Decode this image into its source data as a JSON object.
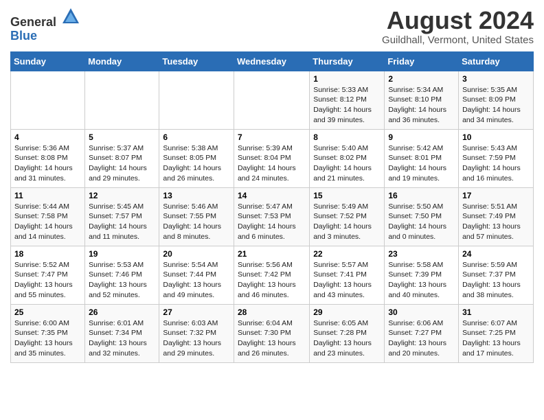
{
  "header": {
    "logo_general": "General",
    "logo_blue": "Blue",
    "month": "August 2024",
    "location": "Guildhall, Vermont, United States"
  },
  "days_of_week": [
    "Sunday",
    "Monday",
    "Tuesday",
    "Wednesday",
    "Thursday",
    "Friday",
    "Saturday"
  ],
  "weeks": [
    [
      {
        "day": "",
        "info": ""
      },
      {
        "day": "",
        "info": ""
      },
      {
        "day": "",
        "info": ""
      },
      {
        "day": "",
        "info": ""
      },
      {
        "day": "1",
        "info": "Sunrise: 5:33 AM\nSunset: 8:12 PM\nDaylight: 14 hours and 39 minutes."
      },
      {
        "day": "2",
        "info": "Sunrise: 5:34 AM\nSunset: 8:10 PM\nDaylight: 14 hours and 36 minutes."
      },
      {
        "day": "3",
        "info": "Sunrise: 5:35 AM\nSunset: 8:09 PM\nDaylight: 14 hours and 34 minutes."
      }
    ],
    [
      {
        "day": "4",
        "info": "Sunrise: 5:36 AM\nSunset: 8:08 PM\nDaylight: 14 hours and 31 minutes."
      },
      {
        "day": "5",
        "info": "Sunrise: 5:37 AM\nSunset: 8:07 PM\nDaylight: 14 hours and 29 minutes."
      },
      {
        "day": "6",
        "info": "Sunrise: 5:38 AM\nSunset: 8:05 PM\nDaylight: 14 hours and 26 minutes."
      },
      {
        "day": "7",
        "info": "Sunrise: 5:39 AM\nSunset: 8:04 PM\nDaylight: 14 hours and 24 minutes."
      },
      {
        "day": "8",
        "info": "Sunrise: 5:40 AM\nSunset: 8:02 PM\nDaylight: 14 hours and 21 minutes."
      },
      {
        "day": "9",
        "info": "Sunrise: 5:42 AM\nSunset: 8:01 PM\nDaylight: 14 hours and 19 minutes."
      },
      {
        "day": "10",
        "info": "Sunrise: 5:43 AM\nSunset: 7:59 PM\nDaylight: 14 hours and 16 minutes."
      }
    ],
    [
      {
        "day": "11",
        "info": "Sunrise: 5:44 AM\nSunset: 7:58 PM\nDaylight: 14 hours and 14 minutes."
      },
      {
        "day": "12",
        "info": "Sunrise: 5:45 AM\nSunset: 7:57 PM\nDaylight: 14 hours and 11 minutes."
      },
      {
        "day": "13",
        "info": "Sunrise: 5:46 AM\nSunset: 7:55 PM\nDaylight: 14 hours and 8 minutes."
      },
      {
        "day": "14",
        "info": "Sunrise: 5:47 AM\nSunset: 7:53 PM\nDaylight: 14 hours and 6 minutes."
      },
      {
        "day": "15",
        "info": "Sunrise: 5:49 AM\nSunset: 7:52 PM\nDaylight: 14 hours and 3 minutes."
      },
      {
        "day": "16",
        "info": "Sunrise: 5:50 AM\nSunset: 7:50 PM\nDaylight: 14 hours and 0 minutes."
      },
      {
        "day": "17",
        "info": "Sunrise: 5:51 AM\nSunset: 7:49 PM\nDaylight: 13 hours and 57 minutes."
      }
    ],
    [
      {
        "day": "18",
        "info": "Sunrise: 5:52 AM\nSunset: 7:47 PM\nDaylight: 13 hours and 55 minutes."
      },
      {
        "day": "19",
        "info": "Sunrise: 5:53 AM\nSunset: 7:46 PM\nDaylight: 13 hours and 52 minutes."
      },
      {
        "day": "20",
        "info": "Sunrise: 5:54 AM\nSunset: 7:44 PM\nDaylight: 13 hours and 49 minutes."
      },
      {
        "day": "21",
        "info": "Sunrise: 5:56 AM\nSunset: 7:42 PM\nDaylight: 13 hours and 46 minutes."
      },
      {
        "day": "22",
        "info": "Sunrise: 5:57 AM\nSunset: 7:41 PM\nDaylight: 13 hours and 43 minutes."
      },
      {
        "day": "23",
        "info": "Sunrise: 5:58 AM\nSunset: 7:39 PM\nDaylight: 13 hours and 40 minutes."
      },
      {
        "day": "24",
        "info": "Sunrise: 5:59 AM\nSunset: 7:37 PM\nDaylight: 13 hours and 38 minutes."
      }
    ],
    [
      {
        "day": "25",
        "info": "Sunrise: 6:00 AM\nSunset: 7:35 PM\nDaylight: 13 hours and 35 minutes."
      },
      {
        "day": "26",
        "info": "Sunrise: 6:01 AM\nSunset: 7:34 PM\nDaylight: 13 hours and 32 minutes."
      },
      {
        "day": "27",
        "info": "Sunrise: 6:03 AM\nSunset: 7:32 PM\nDaylight: 13 hours and 29 minutes."
      },
      {
        "day": "28",
        "info": "Sunrise: 6:04 AM\nSunset: 7:30 PM\nDaylight: 13 hours and 26 minutes."
      },
      {
        "day": "29",
        "info": "Sunrise: 6:05 AM\nSunset: 7:28 PM\nDaylight: 13 hours and 23 minutes."
      },
      {
        "day": "30",
        "info": "Sunrise: 6:06 AM\nSunset: 7:27 PM\nDaylight: 13 hours and 20 minutes."
      },
      {
        "day": "31",
        "info": "Sunrise: 6:07 AM\nSunset: 7:25 PM\nDaylight: 13 hours and 17 minutes."
      }
    ]
  ]
}
